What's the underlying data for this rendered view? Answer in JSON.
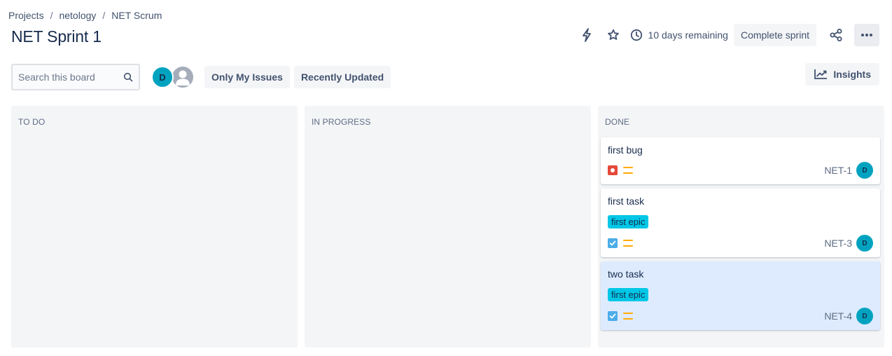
{
  "breadcrumb": {
    "items": [
      "Projects",
      "netology",
      "NET Scrum"
    ],
    "separator": "/"
  },
  "page_title": "NET Sprint 1",
  "header": {
    "remaining_text": "10 days remaining",
    "complete_sprint_label": "Complete sprint",
    "icons": [
      "lightning-icon",
      "star-icon",
      "clock-icon",
      "share-icon",
      "more-icon"
    ]
  },
  "toolbar": {
    "search_placeholder": "Search this board",
    "avatar_initial": "D",
    "filters": [
      "Only My Issues",
      "Recently Updated"
    ],
    "insights_label": "Insights"
  },
  "colors": {
    "accent_avatar": "#00a3bf",
    "epic": "#00c7e6",
    "bug": "#e5493a",
    "task": "#4bade8",
    "priority_medium": "#ffab00",
    "selected_card": "#deebff"
  },
  "columns": [
    {
      "title": "TO DO",
      "cards": []
    },
    {
      "title": "IN PROGRESS",
      "cards": []
    },
    {
      "title": "DONE",
      "cards": [
        {
          "summary": "first bug",
          "epic": "",
          "type": "bug",
          "priority": "medium",
          "key": "NET-1",
          "assignee": "D",
          "selected": false
        },
        {
          "summary": "first task",
          "epic": "first epic",
          "type": "task",
          "priority": "medium",
          "key": "NET-3",
          "assignee": "D",
          "selected": false
        },
        {
          "summary": "two task",
          "epic": "first epic",
          "type": "task",
          "priority": "medium",
          "key": "NET-4",
          "assignee": "D",
          "selected": true
        }
      ]
    }
  ]
}
